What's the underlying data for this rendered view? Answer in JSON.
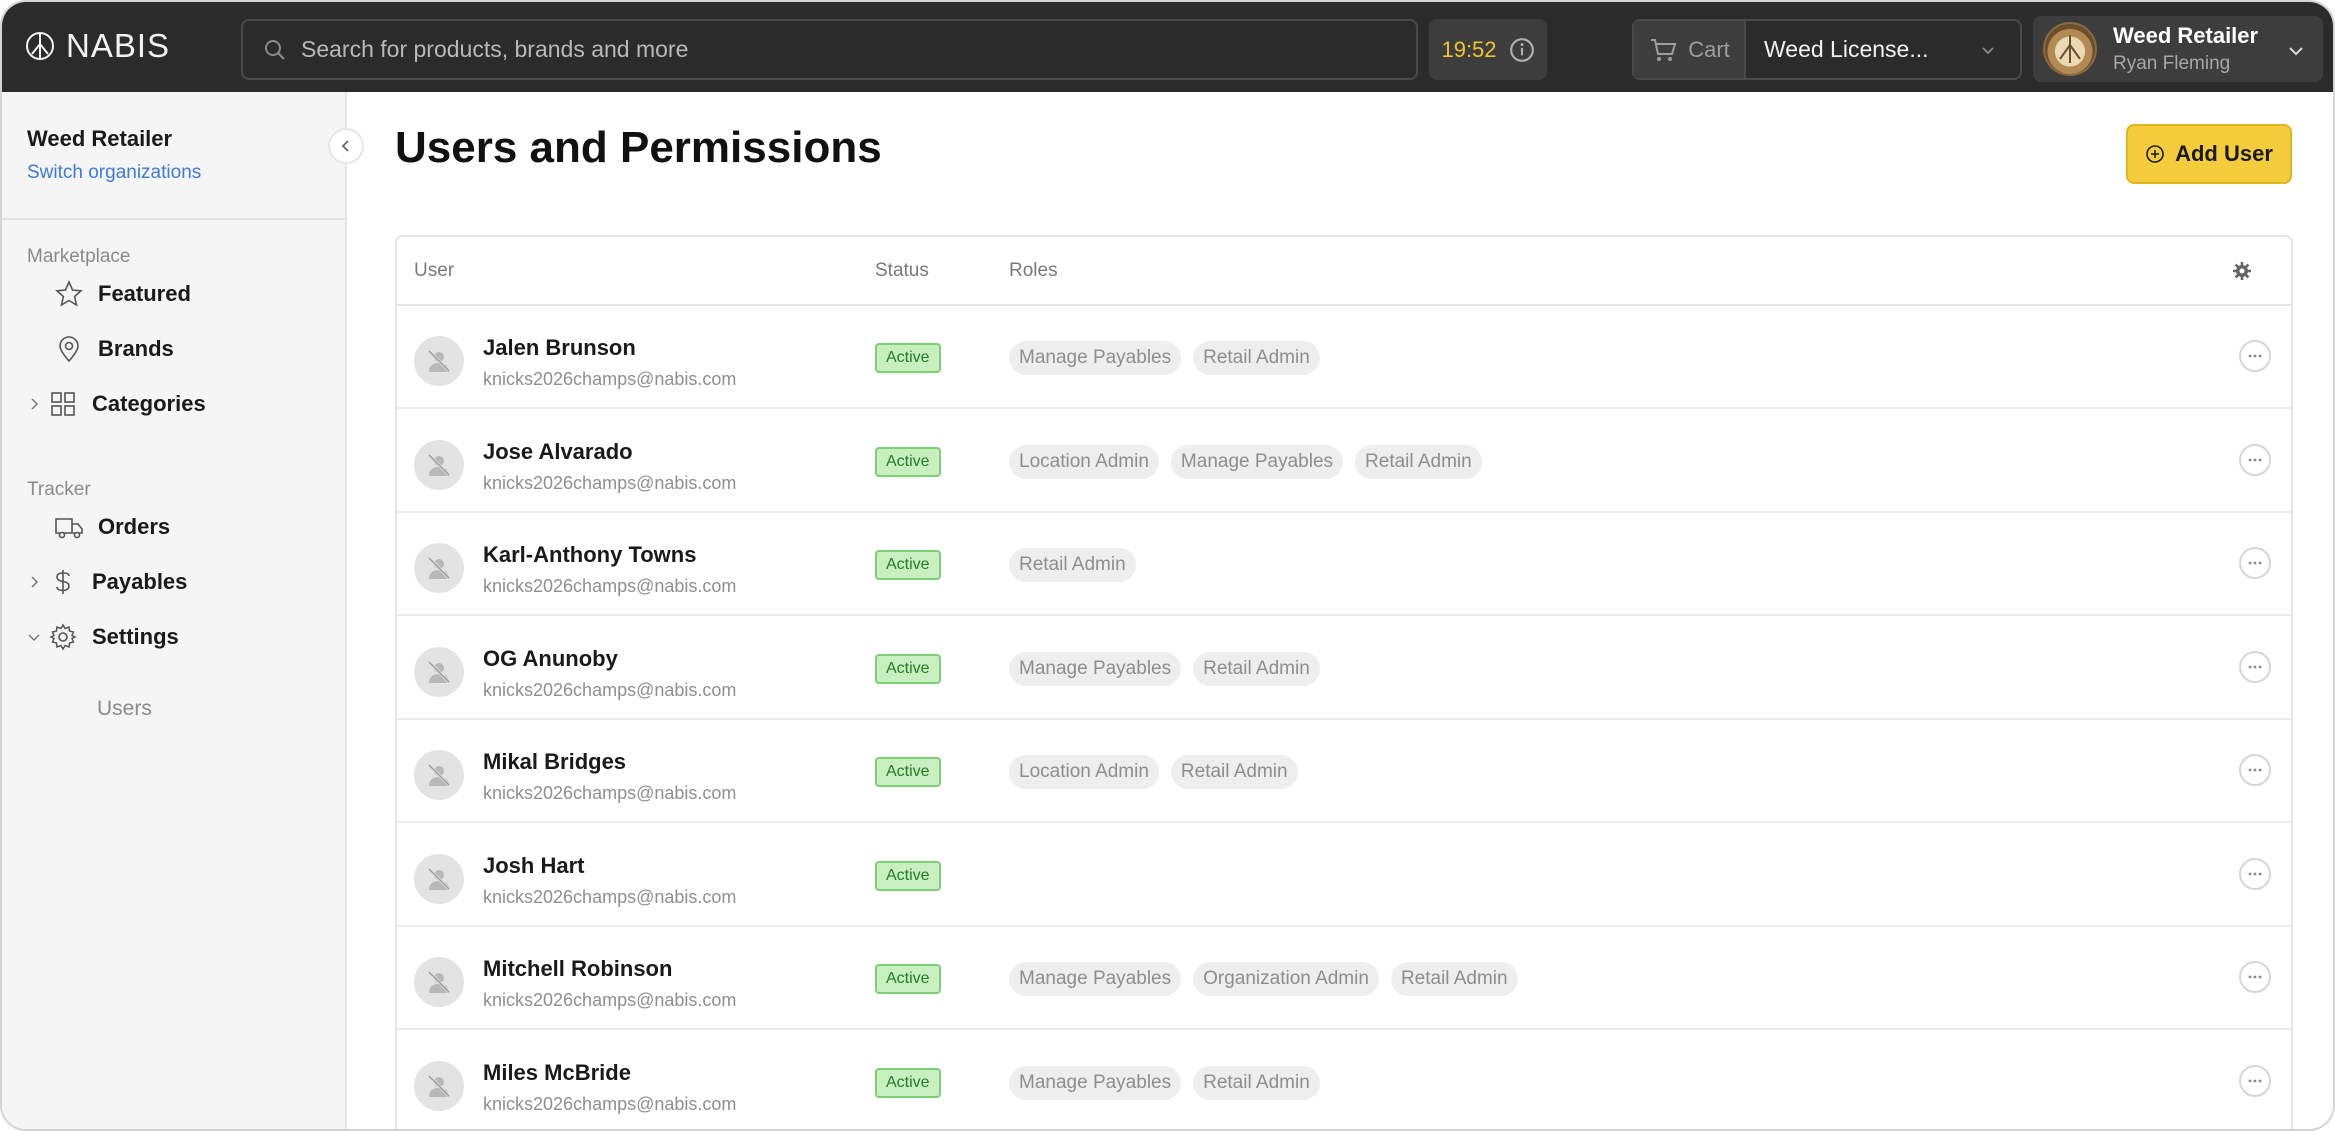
{
  "topbar": {
    "logo_text": "NABIS",
    "search_placeholder": "Search for products, brands and more",
    "timer": "19:52",
    "cart_label": "Cart",
    "license_label": "Weed License...",
    "account_name": "Weed Retailer",
    "account_user": "Ryan Fleming"
  },
  "sidebar": {
    "org_name": "Weed Retailer",
    "switch_org": "Switch organizations",
    "marketplace_label": "Marketplace",
    "featured": "Featured",
    "brands": "Brands",
    "categories": "Categories",
    "tracker_label": "Tracker",
    "orders": "Orders",
    "payables": "Payables",
    "settings": "Settings",
    "users": "Users"
  },
  "main": {
    "title": "Users and Permissions",
    "add_user": "Add User",
    "columns": {
      "user": "User",
      "status": "Status",
      "roles": "Roles"
    }
  },
  "users": [
    {
      "name": "Jalen Brunson",
      "email": "knicks2026champs@nabis.com",
      "status": "Active",
      "roles": [
        "Manage Payables",
        "Retail Admin"
      ]
    },
    {
      "name": "Jose Alvarado",
      "email": "knicks2026champs@nabis.com",
      "status": "Active",
      "roles": [
        "Location Admin",
        "Manage Payables",
        "Retail Admin"
      ]
    },
    {
      "name": "Karl-Anthony Towns",
      "email": "knicks2026champs@nabis.com",
      "status": "Active",
      "roles": [
        "Retail Admin"
      ]
    },
    {
      "name": "OG Anunoby",
      "email": "knicks2026champs@nabis.com",
      "status": "Active",
      "roles": [
        "Manage Payables",
        "Retail Admin"
      ]
    },
    {
      "name": "Mikal Bridges",
      "email": "knicks2026champs@nabis.com",
      "status": "Active",
      "roles": [
        "Location Admin",
        "Retail Admin"
      ]
    },
    {
      "name": "Josh Hart",
      "email": "knicks2026champs@nabis.com",
      "status": "Active",
      "roles": []
    },
    {
      "name": "Mitchell Robinson",
      "email": "knicks2026champs@nabis.com",
      "status": "Active",
      "roles": [
        "Manage Payables",
        "Organization Admin",
        "Retail Admin"
      ]
    },
    {
      "name": "Miles McBride",
      "email": "knicks2026champs@nabis.com",
      "status": "Active",
      "roles": [
        "Manage Payables",
        "Retail Admin"
      ]
    }
  ],
  "colors": {
    "accent": "#f5cd3c",
    "link": "#3f7ad6",
    "status_active_bg": "#c7efc0",
    "topbar": "#2b2b2b"
  }
}
